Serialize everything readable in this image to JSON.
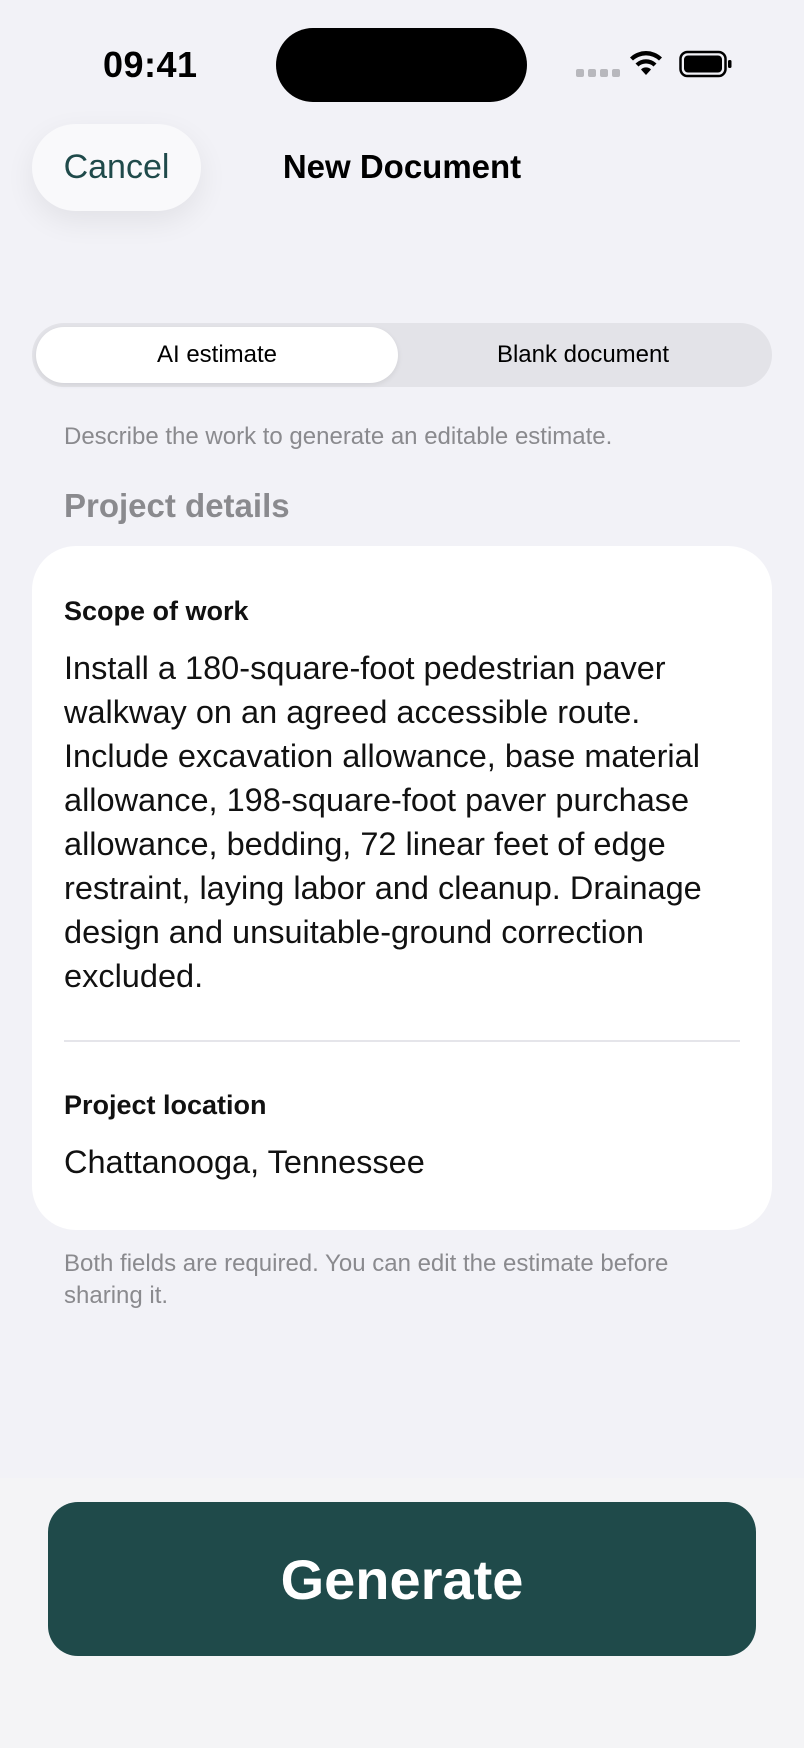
{
  "status_bar": {
    "time": "09:41"
  },
  "nav": {
    "cancel_label": "Cancel",
    "title": "New Document"
  },
  "segmented": {
    "options": [
      "AI estimate",
      "Blank document"
    ],
    "selected": "AI estimate"
  },
  "hint": "Describe the work to generate an editable estimate.",
  "section_title": "Project details",
  "form": {
    "scope_label": "Scope of work",
    "scope_value": "Install a 180-square-foot pedestrian paver walkway on an agreed accessible route. Include excavation allowance, base material allowance, 198-square-foot paver purchase allowance, bedding, 72 linear feet of edge restraint, laying labor and cleanup. Drainage design and unsuitable-ground correction excluded.",
    "location_label": "Project location",
    "location_value": "Chattanooga, Tennessee"
  },
  "footnote": "Both fields are required. You can edit the estimate before sharing it.",
  "generate_label": "Generate",
  "colors": {
    "accent": "#1f4a4a",
    "background": "#f2f2f7",
    "secondary_text": "#8a8a8e"
  }
}
